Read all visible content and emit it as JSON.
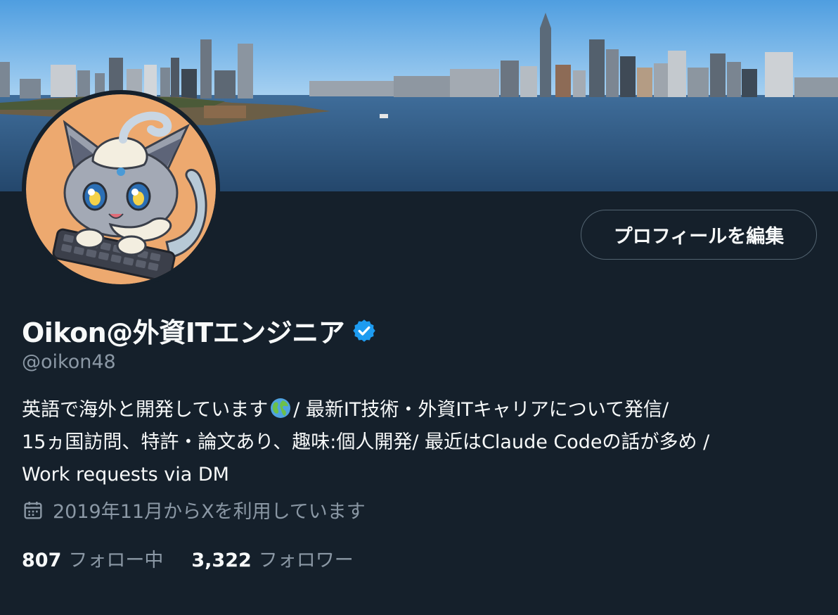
{
  "profile": {
    "display_name": "Oikon@外資ITエンジニア",
    "handle": "@oikon48",
    "verified_icon": "verified-badge-icon",
    "edit_button_label": "プロフィールを編集",
    "bio_lines": [
      "英語で海外と開発しています",
      "/ 最新IT技術・外資ITキャリアについて発信/",
      "15ヵ国訪問、特許・論文あり、趣味:個人開発/ 最近はClaude Codeの話が多め /",
      "Work requests via DM"
    ],
    "joined_text": "2019年11月からXを利用しています",
    "following_count": "807",
    "following_label": "フォロー中",
    "followers_count": "3,322",
    "followers_label": "フォロワー"
  },
  "colors": {
    "background": "#15202b",
    "primary_text": "#f7f9f9",
    "secondary_text": "#8b98a5",
    "verified_blue": "#1d9bf0",
    "button_border": "#536471"
  },
  "icons": {
    "bio_emoji": "globe-icon",
    "joined": "calendar-icon"
  }
}
